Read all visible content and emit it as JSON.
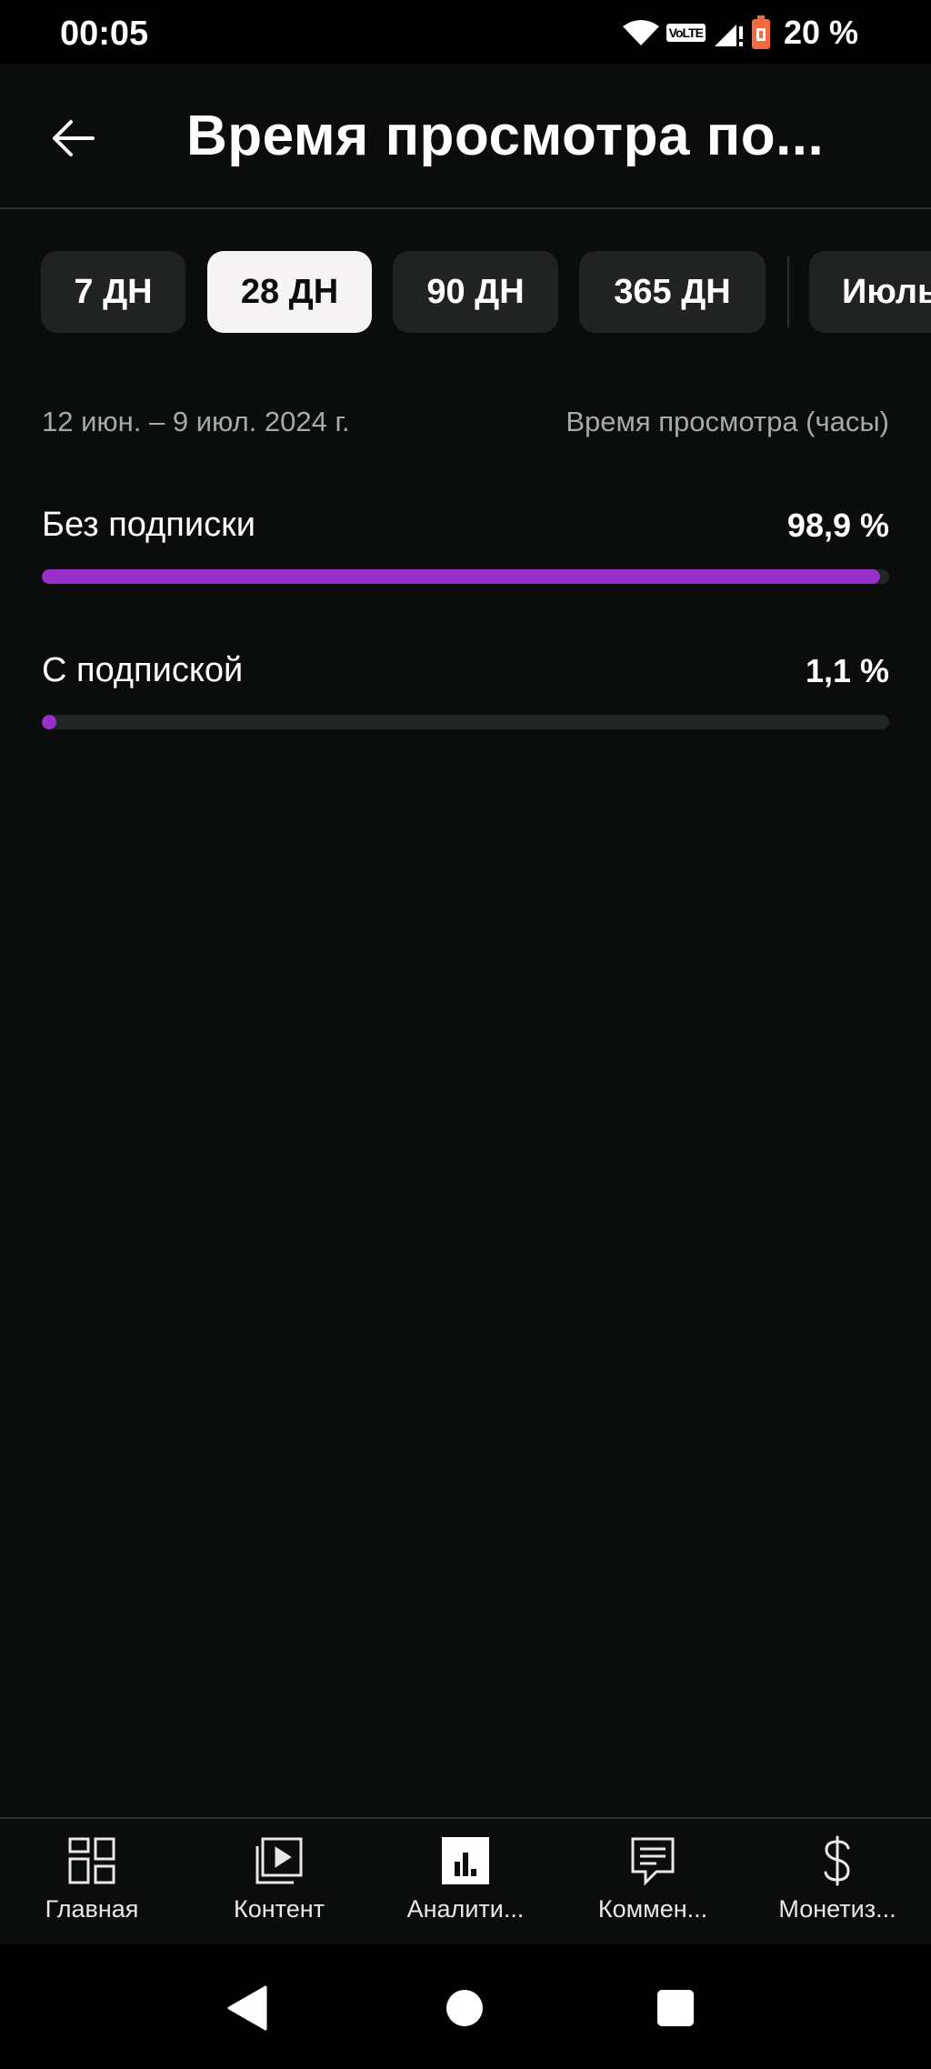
{
  "status_bar": {
    "time": "00:05",
    "network_badge": "VoLTE",
    "battery_text": "20 %",
    "icons": [
      "wifi-icon",
      "volte-icon",
      "signal-icon",
      "battery-low-icon"
    ]
  },
  "app_bar": {
    "back_icon": "arrow-left-icon",
    "title": "Время просмотра по..."
  },
  "periods": {
    "items": [
      {
        "label": "7 ДН",
        "selected": false
      },
      {
        "label": "28 ДН",
        "selected": true
      },
      {
        "label": "90 ДН",
        "selected": false
      },
      {
        "label": "365 ДН",
        "selected": false
      },
      {
        "label": "Июль",
        "selected": false
      }
    ]
  },
  "report": {
    "date_range": "12 июн. – 9 июл. 2024 г.",
    "metric": "Время просмотра (часы)",
    "rows": [
      {
        "label": "Без подписки",
        "value": "98,9 %",
        "fraction": 0.989
      },
      {
        "label": "С подпиской",
        "value": "1,1 %",
        "fraction": 0.011
      }
    ]
  },
  "bottom_nav": {
    "items": [
      {
        "label": "Главная",
        "icon": "dashboard-icon"
      },
      {
        "label": "Контент",
        "icon": "content-icon"
      },
      {
        "label": "Аналити...",
        "icon": "analytics-icon",
        "active": true
      },
      {
        "label": "Коммен...",
        "icon": "comments-icon"
      },
      {
        "label": "Монетиз...",
        "icon": "dollar-icon"
      }
    ]
  },
  "colors": {
    "background": "#0b0d0c",
    "accent": "#9a2ec9",
    "chip": "#212322",
    "chip_selected": "#f7f4f6",
    "muted_text": "#a7aaa9"
  }
}
